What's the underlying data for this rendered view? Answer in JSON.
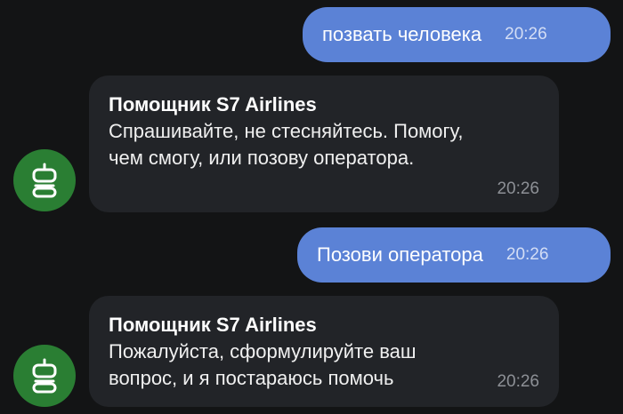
{
  "messages": [
    {
      "direction": "outgoing",
      "text": "позвать человека",
      "time": "20:26"
    },
    {
      "direction": "incoming",
      "sender": "Помощник S7 Airlines",
      "text": "Спрашивайте, не стесняйтесь. Помогу,\nчем смогу, или позову оператора.",
      "time": "20:26",
      "avatar_icon": "robot-icon"
    },
    {
      "direction": "outgoing",
      "text": "Позови оператора",
      "time": "20:26"
    },
    {
      "direction": "incoming",
      "sender": "Помощник S7 Airlines",
      "text": "Пожалуйста, сформулируйте ваш\nвопрос, и я постараюсь помочь",
      "time": "20:26",
      "avatar_icon": "robot-icon"
    }
  ],
  "colors": {
    "background": "#131415",
    "outgoing_bubble": "#5b82d6",
    "incoming_bubble": "#222428",
    "avatar": "#2a7e33"
  }
}
